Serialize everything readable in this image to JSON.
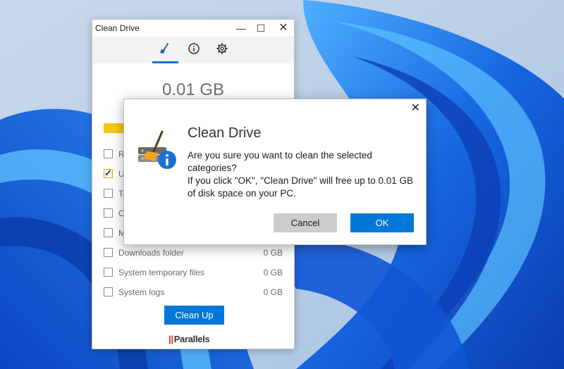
{
  "app": {
    "title": "Clean Drive",
    "window_controls": {
      "minimize": "—",
      "maximize": "☐",
      "close": "✕"
    },
    "toolbar": [
      "broom-icon",
      "info-icon",
      "gear-icon"
    ],
    "size_label": "0.01 GB",
    "items": [
      {
        "label": "R",
        "value": "",
        "checked": false
      },
      {
        "label": "U",
        "value": "",
        "checked": true
      },
      {
        "label": "Te",
        "value": "",
        "checked": false
      },
      {
        "label": "O",
        "value": "",
        "checked": false
      },
      {
        "label": "M",
        "value": "",
        "checked": false
      },
      {
        "label": "Downloads folder",
        "value": "0 GB",
        "checked": false
      },
      {
        "label": "System temporary files",
        "value": "0 GB",
        "checked": false
      },
      {
        "label": "System logs",
        "value": "0 GB",
        "checked": false
      }
    ],
    "cleanup_label": "Clean Up",
    "logo_text": "Parallels",
    "accent": "#0078d7",
    "bar_color": "#f2c811"
  },
  "dialog": {
    "close": "✕",
    "title": "Clean Drive",
    "lines": [
      "Are you sure you want to clean the selected",
      "categories?",
      "If you click \"OK\", \"Clean Drive\" will free up to 0.01 GB",
      "of disk space on your PC."
    ],
    "cancel_label": "Cancel",
    "ok_label": "OK"
  }
}
